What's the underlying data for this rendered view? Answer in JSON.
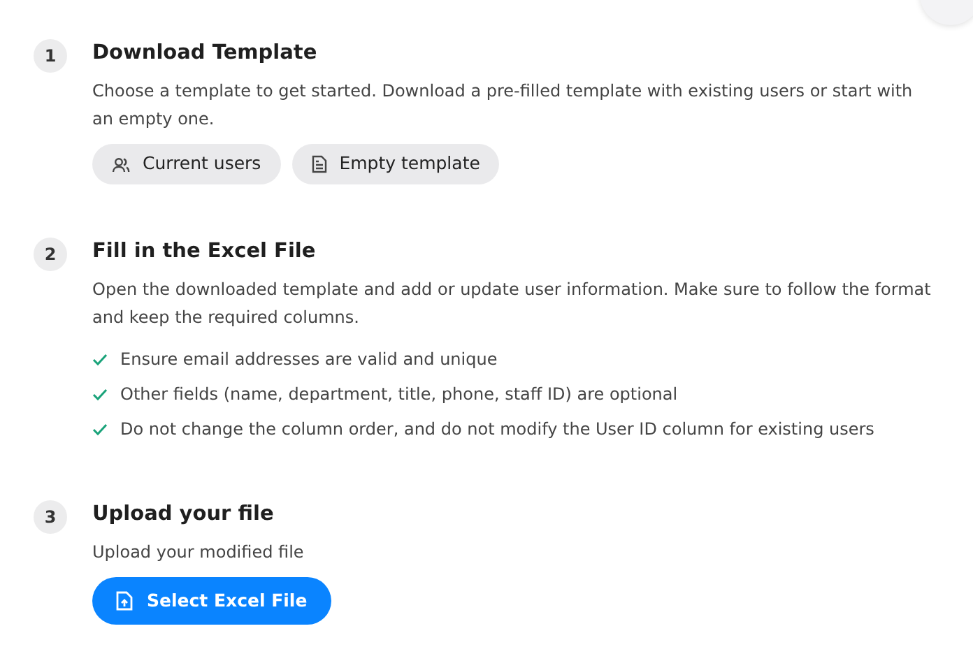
{
  "steps": [
    {
      "number": "1",
      "title": "Download Template",
      "description": "Choose a template to get started. Download a pre-filled template with existing users or start with an empty one.",
      "buttons": [
        {
          "label": "Current users",
          "kind": "users"
        },
        {
          "label": "Empty template",
          "kind": "document"
        }
      ]
    },
    {
      "number": "2",
      "title": "Fill in the Excel File",
      "description": "Open the downloaded template and add or update user information. Make sure to follow the format and keep the required columns.",
      "checklist": [
        "Ensure email addresses are valid and unique",
        "Other fields (name, department, title, phone, staff ID) are optional",
        "Do not change the column order, and do not modify the User ID column for existing users"
      ]
    },
    {
      "number": "3",
      "title": "Upload your file",
      "description": "Upload your modified file",
      "buttons": [
        {
          "label": "Select Excel File",
          "kind": "upload"
        }
      ]
    }
  ]
}
